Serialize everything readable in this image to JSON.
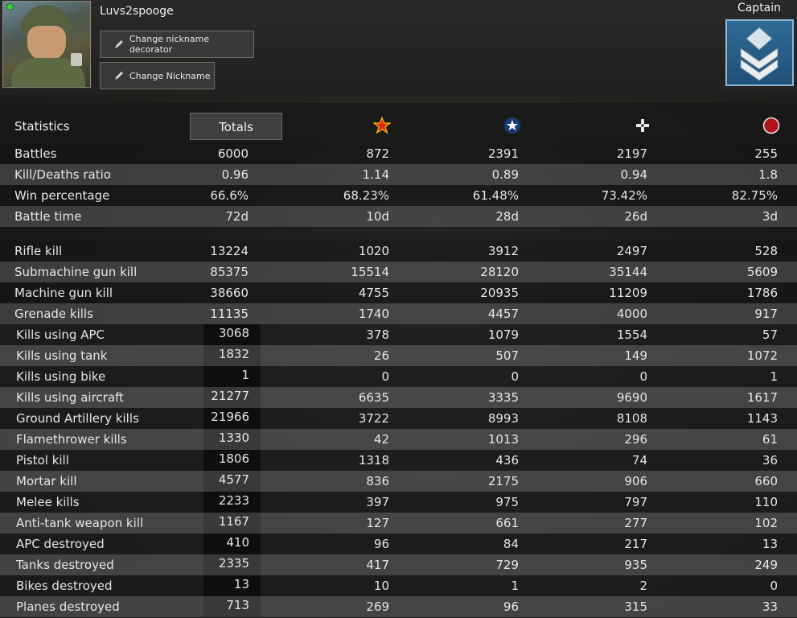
{
  "profile": {
    "nickname": "Luvs2spooge",
    "change_decorator_label": "Change nickname decorator",
    "change_nickname_label": "Change Nickname",
    "rank_title": "Captain"
  },
  "table": {
    "header_label": "Statistics",
    "totals_tab_label": "Totals",
    "faction_icons": [
      "red-star-icon",
      "allied-star-icon",
      "axis-cross-icon",
      "red-circle-icon"
    ],
    "summary_rows": [
      {
        "label": "Battles",
        "values": [
          "6000",
          "872",
          "2391",
          "2197",
          "255"
        ]
      },
      {
        "label": "Kill/Deaths ratio",
        "values": [
          "0.96",
          "1.14",
          "0.89",
          "0.94",
          "1.8"
        ]
      },
      {
        "label": "Win percentage",
        "values": [
          "66.6%",
          "68.23%",
          "61.48%",
          "73.42%",
          "82.75%"
        ]
      },
      {
        "label": "Battle time",
        "values": [
          "72d",
          "10d",
          "28d",
          "26d",
          "3d"
        ]
      }
    ],
    "kill_rows": [
      {
        "label": "Rifle kill",
        "values": [
          "13224",
          "1020",
          "3912",
          "2497",
          "528"
        ]
      },
      {
        "label": "Submachine gun kill",
        "values": [
          "85375",
          "15514",
          "28120",
          "35144",
          "5609"
        ]
      },
      {
        "label": "Machine gun kill",
        "values": [
          "38660",
          "4755",
          "20935",
          "11209",
          "1786"
        ]
      },
      {
        "label": "Grenade kills",
        "values": [
          "11135",
          "1740",
          "4457",
          "4000",
          "917"
        ]
      }
    ],
    "vehicle_rows": [
      {
        "label": "Kills using APC",
        "values": [
          "3068",
          "378",
          "1079",
          "1554",
          "57"
        ]
      },
      {
        "label": "Kills using tank",
        "values": [
          "1832",
          "26",
          "507",
          "149",
          "1072"
        ]
      },
      {
        "label": "Kills using bike",
        "values": [
          "1",
          "0",
          "0",
          "0",
          "1"
        ]
      },
      {
        "label": "Kills using aircraft",
        "values": [
          "21277",
          "6635",
          "3335",
          "9690",
          "1617"
        ]
      },
      {
        "label": "Ground Artillery kills",
        "values": [
          "21966",
          "3722",
          "8993",
          "8108",
          "1143"
        ]
      },
      {
        "label": "Flamethrower kills",
        "values": [
          "1330",
          "42",
          "1013",
          "296",
          "61"
        ]
      },
      {
        "label": "Pistol kill",
        "values": [
          "1806",
          "1318",
          "436",
          "74",
          "36"
        ]
      },
      {
        "label": "Mortar kill",
        "values": [
          "4577",
          "836",
          "2175",
          "906",
          "660"
        ]
      },
      {
        "label": "Melee kills",
        "values": [
          "2233",
          "397",
          "975",
          "797",
          "110"
        ]
      },
      {
        "label": "Anti-tank weapon kill",
        "values": [
          "1167",
          "127",
          "661",
          "277",
          "102"
        ]
      },
      {
        "label": "APC destroyed",
        "values": [
          "410",
          "96",
          "84",
          "217",
          "13"
        ]
      },
      {
        "label": "Tanks destroyed",
        "values": [
          "2335",
          "417",
          "729",
          "935",
          "249"
        ]
      },
      {
        "label": "Bikes destroyed",
        "values": [
          "13",
          "10",
          "1",
          "2",
          "0"
        ]
      },
      {
        "label": "Planes destroyed",
        "values": [
          "713",
          "269",
          "96",
          "315",
          "33"
        ]
      }
    ]
  }
}
